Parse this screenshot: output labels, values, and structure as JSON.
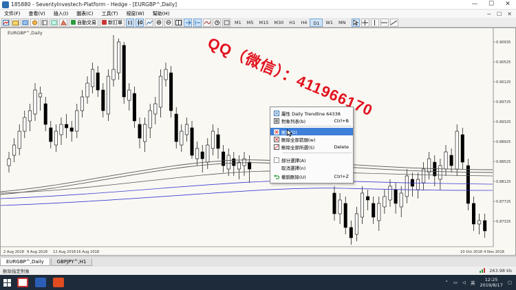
{
  "window": {
    "title": "185880 - SeventyInvestech-Platform - Hedge - [EURGBP^,Daily]",
    "minimize": "—",
    "maximize": "☐",
    "close": "✕"
  },
  "menu": {
    "items": [
      "文件(F)",
      "查看(V)",
      "插入(I)",
      "圖表(C)",
      "工具(T)",
      "視窗(W)",
      "幫助(H)"
    ],
    "right_icons": [
      "−",
      "☐",
      "✕"
    ]
  },
  "toolbar": {
    "auto_trade_label": "自動交易",
    "new_order_label": "新訂單",
    "timeframes": [
      "M1",
      "M5",
      "M15",
      "M30",
      "H1",
      "H4",
      "D1",
      "W1",
      "MN"
    ],
    "active_timeframe": "D1"
  },
  "chart": {
    "symbol_label": "EURGBP^,Daily",
    "price_labels": [
      "0.90935",
      "0.90525",
      "0.90125",
      "0.89725",
      "0.89325",
      "0.88925",
      "0.88525",
      "0.88125",
      "0.87725",
      "0.87325"
    ],
    "date_labels": [
      "2 Aug 2018",
      "9 Aug 2018",
      "12 Aug 2018",
      "16 Aug 2018",
      "10 Oct 2018",
      "4 Nov 2018"
    ]
  },
  "context_menu": {
    "items": [
      {
        "icon": "properties-icon",
        "label": "屬性 Daily Trendline 64338",
        "shortcut": ""
      },
      {
        "icon": "object-list-icon",
        "label": "對象列表(b)",
        "shortcut": "Ctrl+B"
      },
      {
        "icon": "delete-icon",
        "label": "刪除(D)",
        "shortcut": ""
      },
      {
        "icon": "delete-all-icon",
        "label": "刪除全部箭頭(w)",
        "shortcut": ""
      },
      {
        "icon": "delete-all-drawings-icon",
        "label": "刪除全部所選(S)",
        "shortcut": "Delete"
      },
      {
        "icon": "select-icon",
        "label": "部分選擇(A)",
        "shortcut": ""
      },
      {
        "icon": "deselect-icon",
        "label": "取消選擇(n)",
        "shortcut": ""
      },
      {
        "icon": "undo-icon",
        "label": "撤銷刪除(U)",
        "shortcut": "Ctrl+Z"
      }
    ],
    "highlighted_index": 2
  },
  "watermark_text": "QQ（微信）：411966170",
  "tabs": [
    "EURGBP^,Daily",
    "GBPJPY^,H1"
  ],
  "status": {
    "left": "刪除指定對象",
    "kb": "263.98 kb"
  },
  "taskbar": {
    "time": "12:25",
    "date": "2019/8/17",
    "ime": "英"
  },
  "colors": {
    "watermark": "#e1121e",
    "highlight": "#3d7fd9",
    "candle": "#000000",
    "ma_gray": "#555555",
    "ma_blue": "#3a3ad0"
  }
}
